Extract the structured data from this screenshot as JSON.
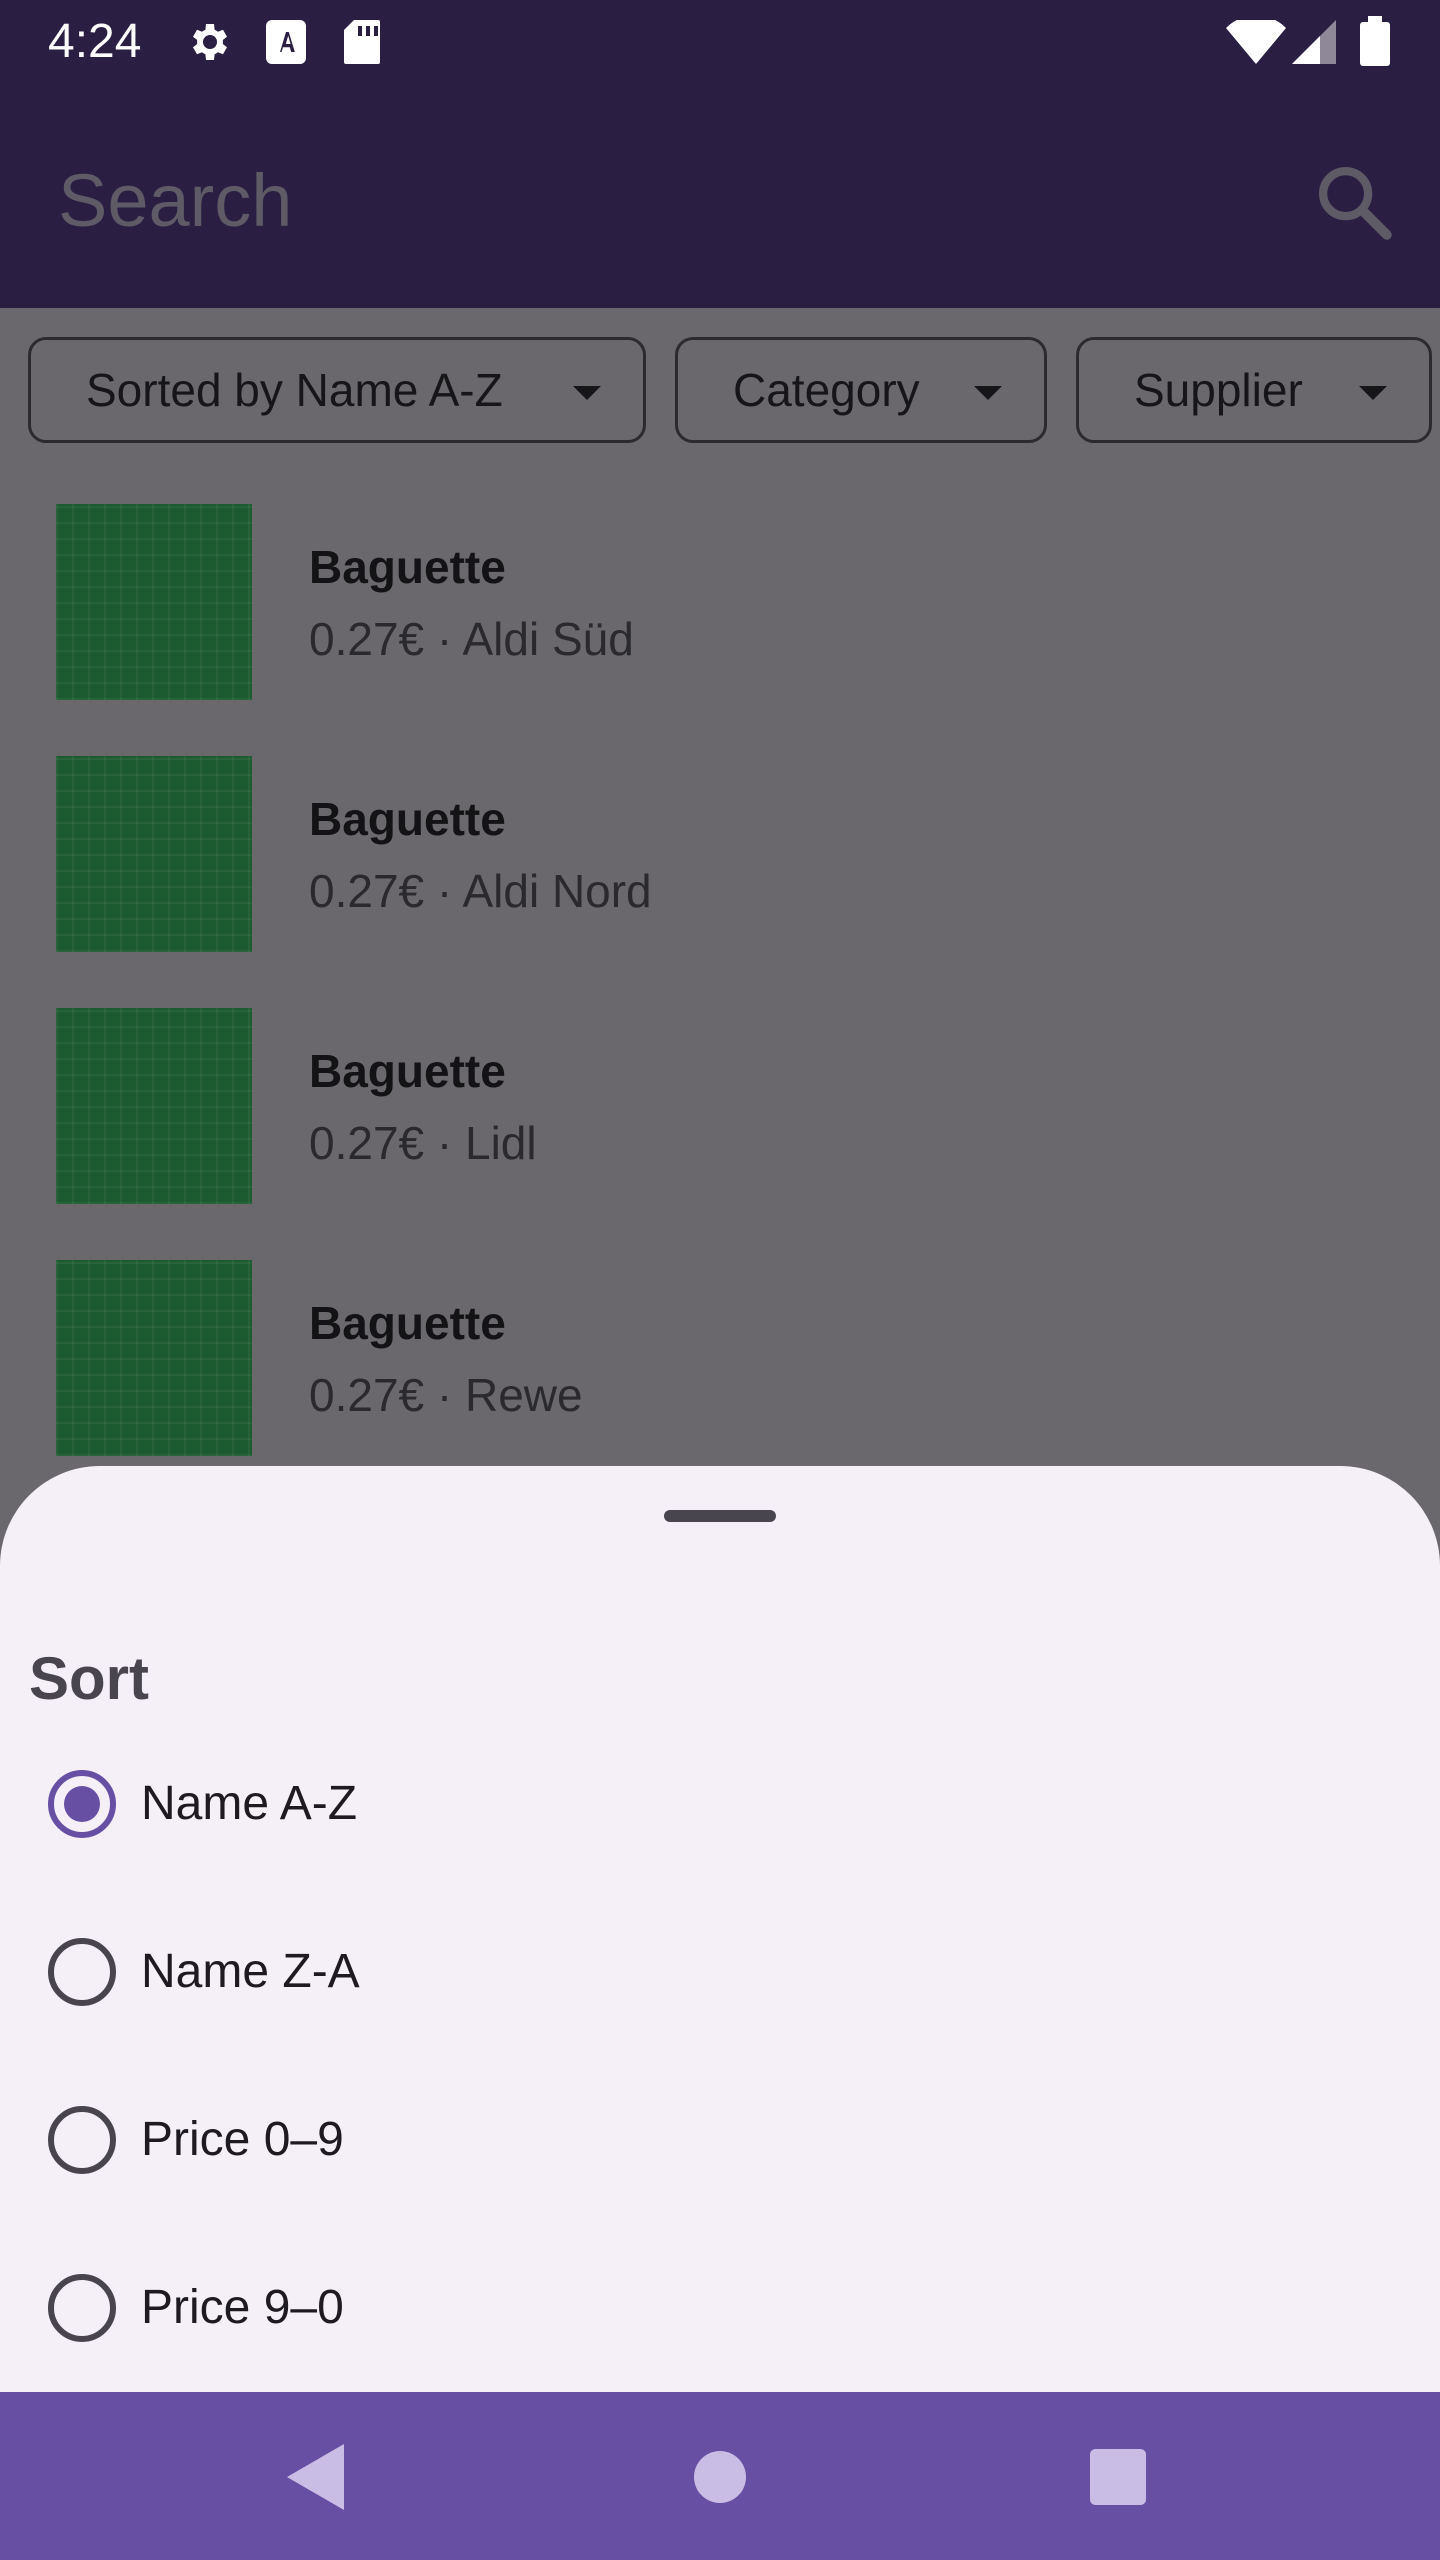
{
  "status_bar": {
    "time": "4:24"
  },
  "search": {
    "placeholder": "Search",
    "value": ""
  },
  "filters": [
    {
      "label": "Sorted by Name A-Z"
    },
    {
      "label": "Category"
    },
    {
      "label": "Supplier"
    }
  ],
  "products": [
    {
      "name": "Baguette",
      "meta": "0.27€ · Aldi Süd"
    },
    {
      "name": "Baguette",
      "meta": "0.27€ · Aldi Nord"
    },
    {
      "name": "Baguette",
      "meta": "0.27€ · Lidl"
    },
    {
      "name": "Baguette",
      "meta": "0.27€ · Rewe"
    }
  ],
  "sort_sheet": {
    "title": "Sort",
    "options": [
      {
        "label": "Name A-Z",
        "selected": true
      },
      {
        "label": "Name Z-A",
        "selected": false
      },
      {
        "label": "Price 0–9",
        "selected": false
      },
      {
        "label": "Price 9–0",
        "selected": false
      }
    ]
  },
  "colors": {
    "app_bar": "#2a1f43",
    "accent": "#6750a4",
    "scrim": "#6a686c",
    "sheet": "#f5f0f8",
    "thumbnail": "#1c5a30"
  },
  "icons": {
    "status": [
      "gear-icon",
      "font-a-icon",
      "sd-card-icon",
      "wifi-icon",
      "signal-icon",
      "battery-icon"
    ],
    "search": "search-icon",
    "nav": [
      "back-icon",
      "home-icon",
      "recents-icon"
    ]
  }
}
